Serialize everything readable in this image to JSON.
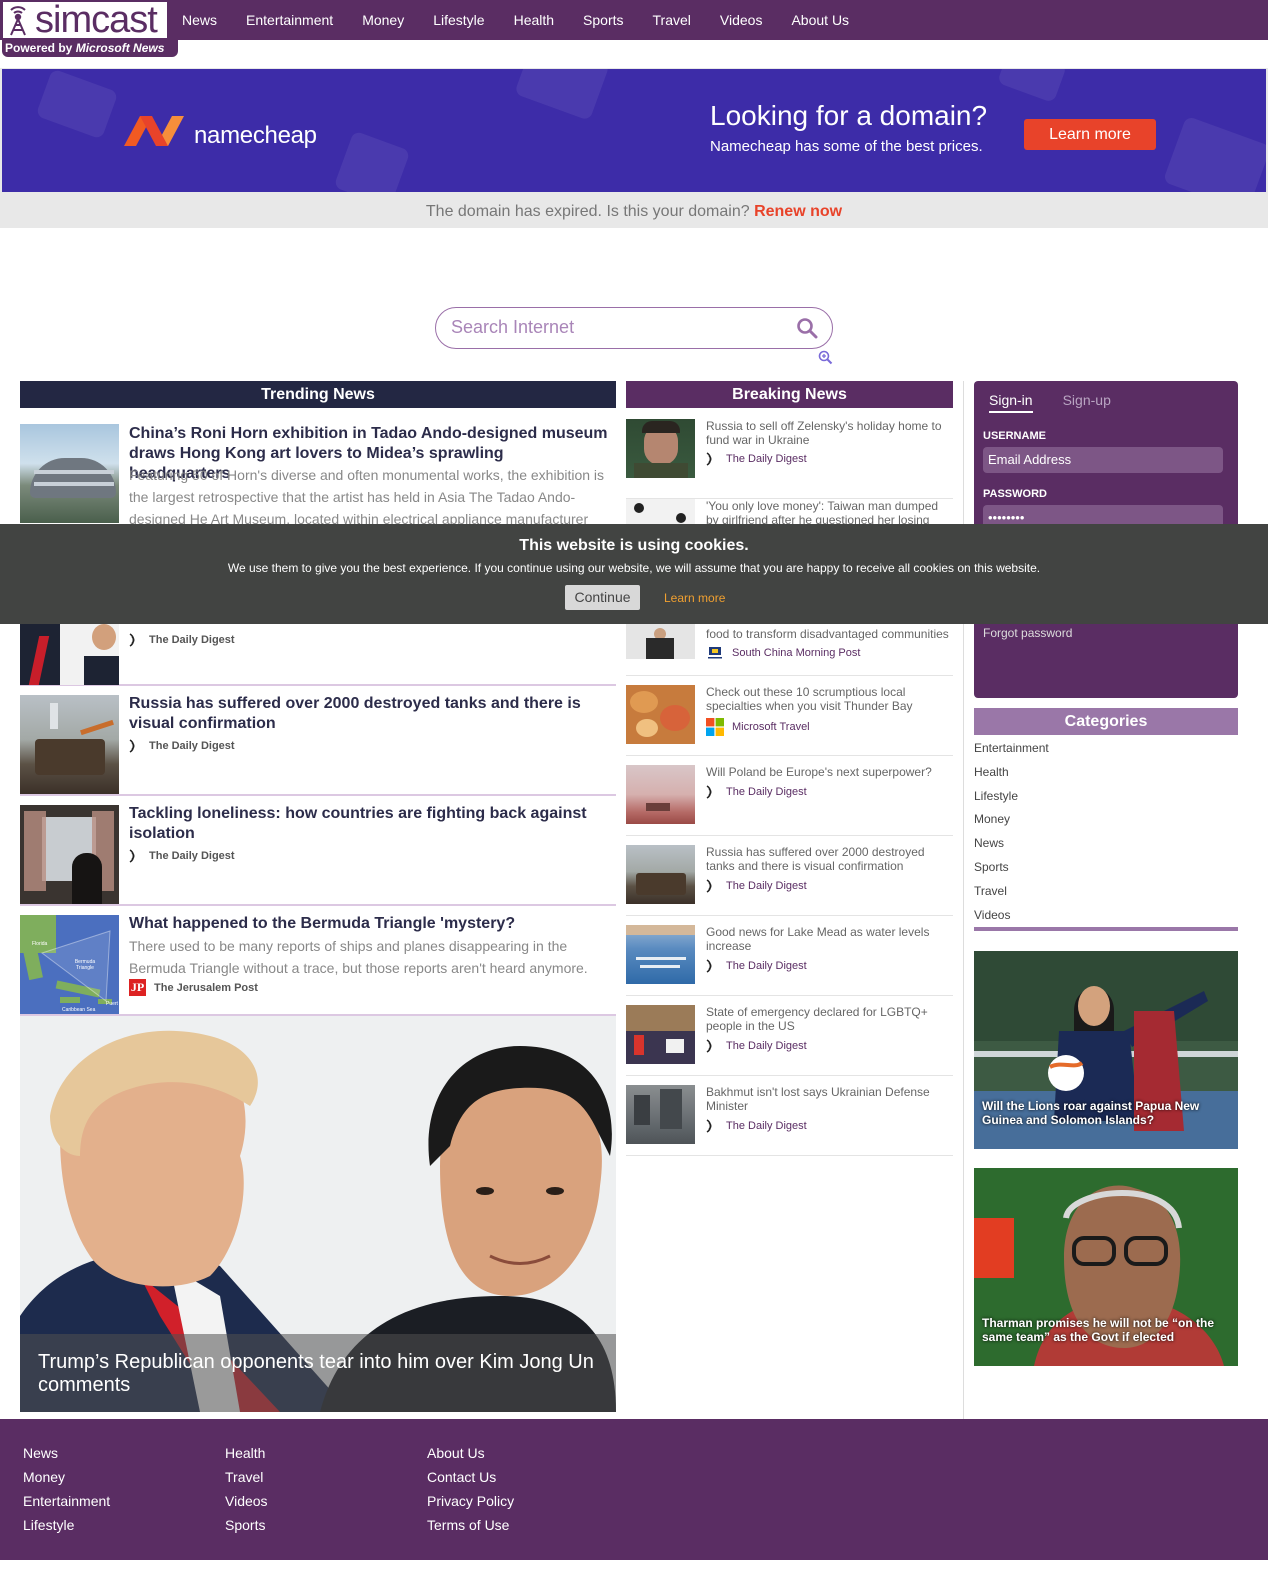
{
  "brand": {
    "name": "simcast",
    "powered_prefix": "Powered by",
    "powered_by": "Microsoft News"
  },
  "nav": [
    "News",
    "Entertainment",
    "Money",
    "Lifestyle",
    "Health",
    "Sports",
    "Travel",
    "Videos",
    "About Us"
  ],
  "ad": {
    "brand": "namecheap",
    "headline": "Looking for a domain?",
    "subline": "Namecheap has some of the best prices.",
    "cta": "Learn more",
    "notice": "The domain has expired. Is this your domain?",
    "notice_link": "Renew now"
  },
  "search": {
    "placeholder": "Search Internet"
  },
  "trending": {
    "header": "Trending News",
    "items": [
      {
        "title": "China’s Roni Horn exhibition in Tadao Ando-designed museum draws Hong Kong art lovers to Midea’s sprawling headquarters",
        "desc": "Featuring 50 of Horn's diverse and often monumental works, the exhibition is the largest retrospective that the artist has held in Asia The Tadao Ando-designed He Art Museum, located within electrical appliance manufacturer",
        "source": ""
      },
      {
        "title": "",
        "desc": "",
        "source": "The Daily Digest"
      },
      {
        "title": "Russia has suffered over 2000 destroyed tanks and there is visual confirmation",
        "desc": "",
        "source": "The Daily Digest"
      },
      {
        "title": "Tackling loneliness: how countries are fighting back against isolation",
        "desc": "",
        "source": "The Daily Digest"
      },
      {
        "title": "What happened to the Bermuda Triangle 'mystery?",
        "desc": "There used to be many reports of ships and planes disappearing in the Bermuda Triangle without a trace, but those reports aren't heard anymore.",
        "source": "The Jerusalem Post"
      }
    ],
    "map_labels": [
      "Florida",
      "Bermuda Triangle",
      "Puert",
      "Caribbean Sea"
    ],
    "hero_caption": "Trump’s Republican opponents tear into him over Kim Jong Un comments"
  },
  "breaking": {
    "header": "Breaking News",
    "items": [
      {
        "title": "Russia to sell off Zelensky's holiday home to fund war in Ukraine",
        "source": "The Daily Digest",
        "icon": "digest-icon"
      },
      {
        "title": "'You only love money': Taiwan man dumped by girlfriend after he questioned her losing",
        "source": "",
        "icon": ""
      },
      {
        "title": "food to transform disadvantaged communities",
        "source": "South China Morning Post",
        "icon": "scmp-icon"
      },
      {
        "title": "Check out these 10 scrumptious local specialties when you visit Thunder Bay",
        "source": "Microsoft Travel",
        "icon": "microsoft-icon"
      },
      {
        "title": "Will Poland be Europe's next superpower?",
        "source": "The Daily Digest",
        "icon": "digest-icon"
      },
      {
        "title": "Russia has suffered over 2000 destroyed tanks and there is visual confirmation",
        "source": "The Daily Digest",
        "icon": "digest-icon"
      },
      {
        "title": "Good news for Lake Mead as water levels increase",
        "source": "The Daily Digest",
        "icon": "digest-icon"
      },
      {
        "title": "State of emergency declared for LGBTQ+ people in the US",
        "source": "The Daily Digest",
        "icon": "digest-icon"
      },
      {
        "title": "Bakhmut isn't lost says Ukrainian Defense Minister",
        "source": "The Daily Digest",
        "icon": "digest-icon"
      }
    ]
  },
  "signin": {
    "tab_signin": "Sign-in",
    "tab_signup": "Sign-up",
    "username_label": "USERNAME",
    "username_placeholder": "Email Address",
    "password_label": "PASSWORD",
    "password_value": "••••••••",
    "forgot": "Forgot password"
  },
  "categories": {
    "header": "Categories",
    "items": [
      "Entertainment",
      "Health",
      "Lifestyle",
      "Money",
      "News",
      "Sports",
      "Travel",
      "Videos"
    ]
  },
  "side_cards": [
    {
      "caption": "Will the Lions roar against Papua New Guinea and Solomon Islands?"
    },
    {
      "caption": "Tharman promises he will not be “on the same team” as the Govt if elected"
    }
  ],
  "cookie": {
    "title": "This website is using cookies.",
    "text": "We use them to give you the best experience. If you continue using our website, we will assume that you are happy to receive all cookies on this website.",
    "continue": "Continue",
    "learn": "Learn more"
  },
  "footer": {
    "col1": [
      "News",
      "Money",
      "Entertainment",
      "Lifestyle"
    ],
    "col2": [
      "Health",
      "Travel",
      "Videos",
      "Sports"
    ],
    "col3": [
      "About Us",
      "Contact Us",
      "Privacy Policy",
      "Terms of Use"
    ]
  },
  "colors": {
    "brand_purple": "#5a2d63",
    "header_navy": "#232743",
    "accent_orange": "#e8432a",
    "category_lilac": "#9a77a8"
  }
}
